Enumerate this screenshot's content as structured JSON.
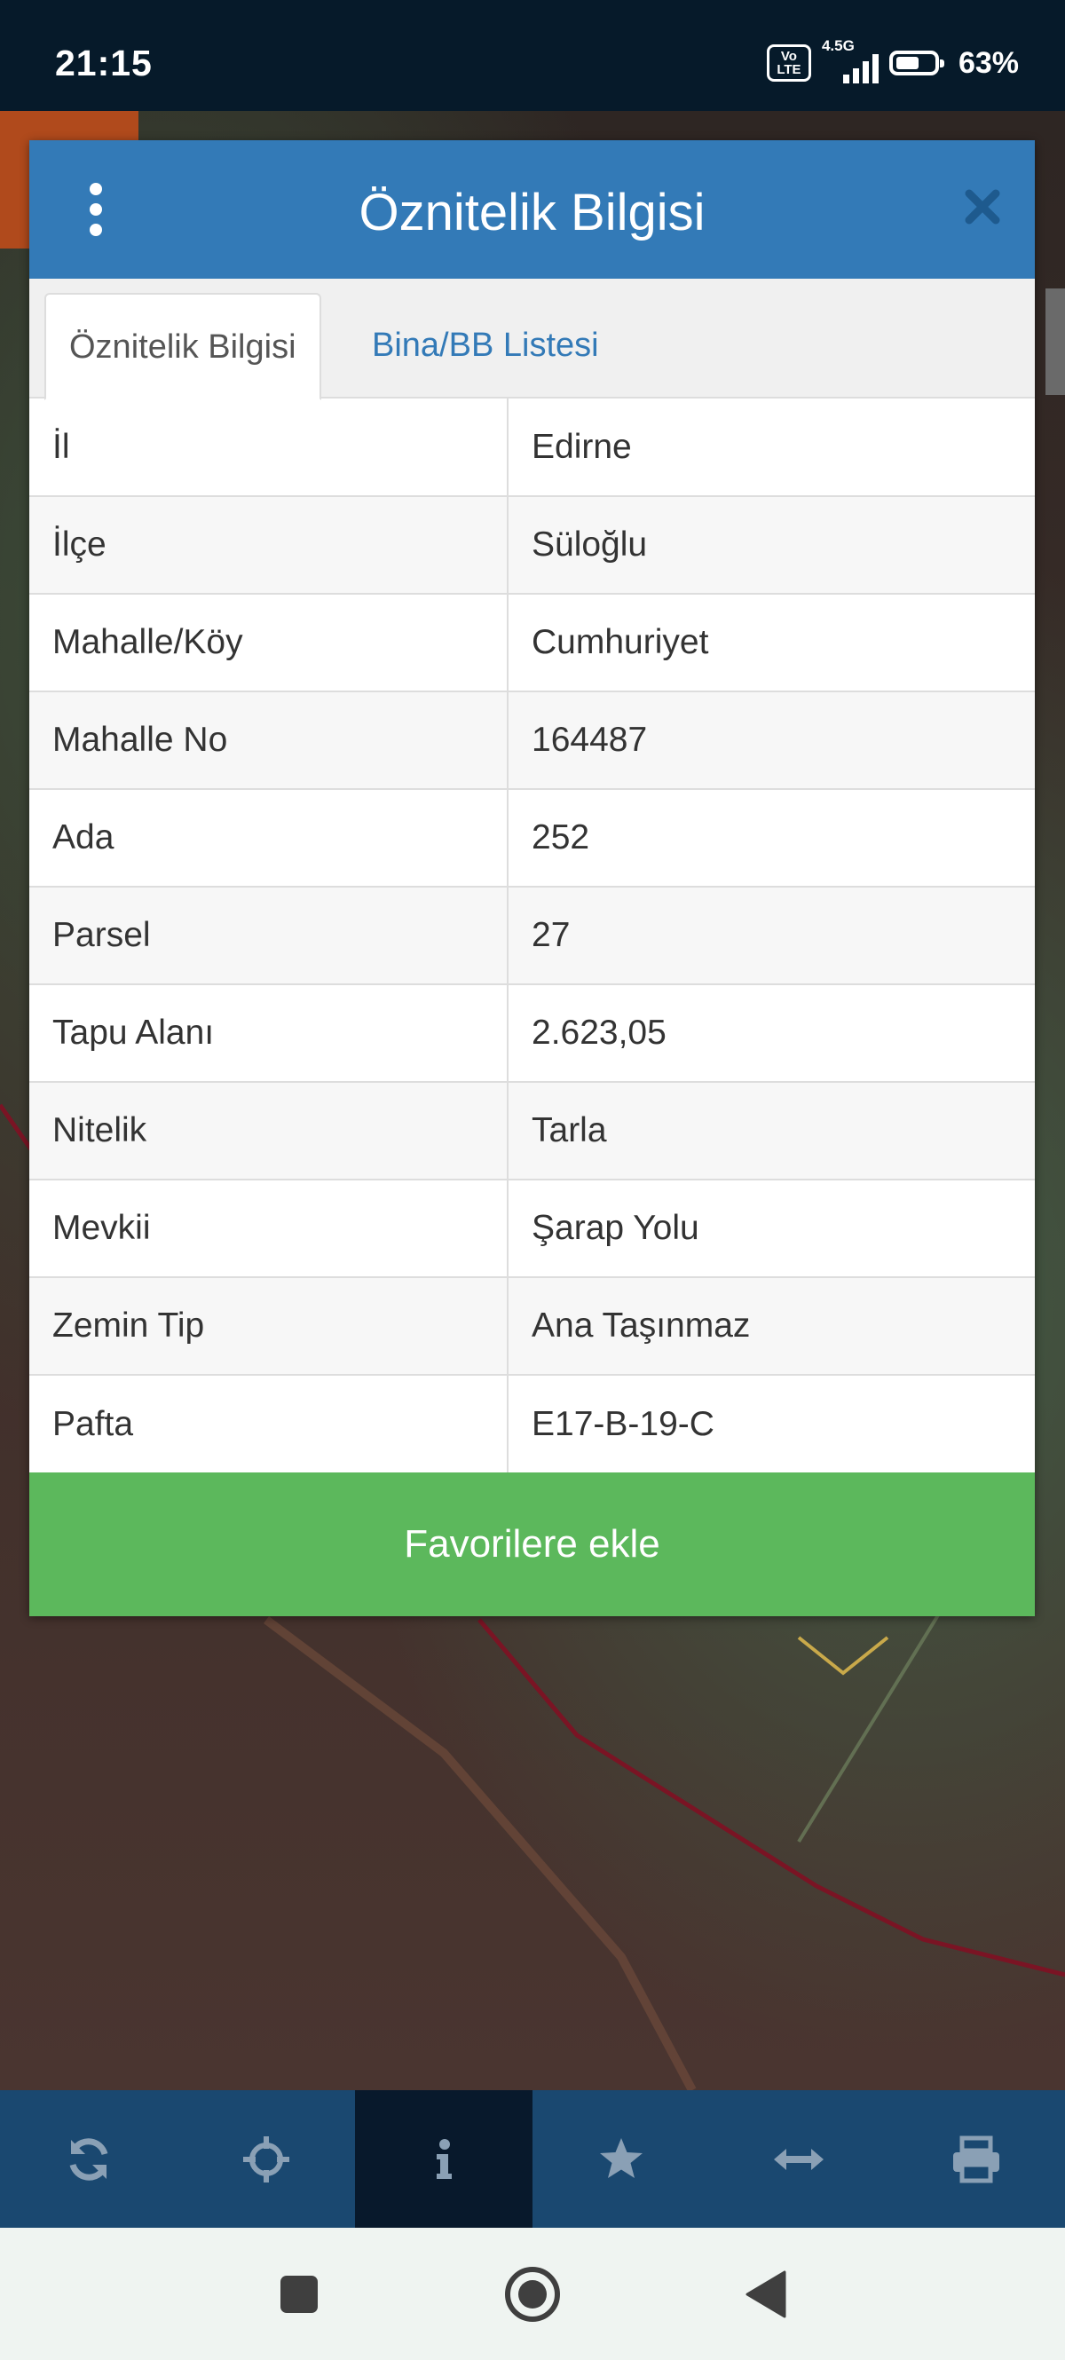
{
  "status_bar": {
    "time": "21:15",
    "volte_label": "Vo LTE",
    "network_type": "4.5G",
    "battery_percent": "63%",
    "battery_level": 0.63
  },
  "dialog": {
    "title": "Öznitelik Bilgisi",
    "menu_icon": "vertical-dots-icon",
    "close_icon": "close-icon",
    "header_color": "#337ab7",
    "tabs": [
      {
        "label": "Öznitelik Bilgisi",
        "active": true
      },
      {
        "label": "Bina/BB Listesi",
        "active": false
      }
    ],
    "rows": [
      {
        "key": "İl",
        "value": "Edirne"
      },
      {
        "key": "İlçe",
        "value": "Süloğlu"
      },
      {
        "key": "Mahalle/Köy",
        "value": "Cumhuriyet"
      },
      {
        "key": "Mahalle No",
        "value": "164487"
      },
      {
        "key": "Ada",
        "value": "252"
      },
      {
        "key": "Parsel",
        "value": "27"
      },
      {
        "key": "Tapu Alanı",
        "value": "2.623,05"
      },
      {
        "key": "Nitelik",
        "value": "Tarla"
      },
      {
        "key": "Mevkii",
        "value": "Şarap Yolu"
      },
      {
        "key": "Zemin Tip",
        "value": "Ana Taşınmaz"
      },
      {
        "key": "Pafta",
        "value": "E17-B-19-C"
      }
    ],
    "favorite_button": "Favorilere ekle",
    "favorite_color": "#5cb85c"
  },
  "toolbar": {
    "items": [
      {
        "icon": "refresh-icon",
        "active": false
      },
      {
        "icon": "crosshair-icon",
        "active": false
      },
      {
        "icon": "info-icon",
        "active": true
      },
      {
        "icon": "star-icon",
        "active": false
      },
      {
        "icon": "measure-arrows-icon",
        "active": false
      },
      {
        "icon": "print-icon",
        "active": false
      }
    ],
    "color": "#1a4870",
    "active_color": "#08192c"
  },
  "navbar": {
    "items": [
      "recents-square-icon",
      "home-circle-icon",
      "back-triangle-icon"
    ]
  }
}
